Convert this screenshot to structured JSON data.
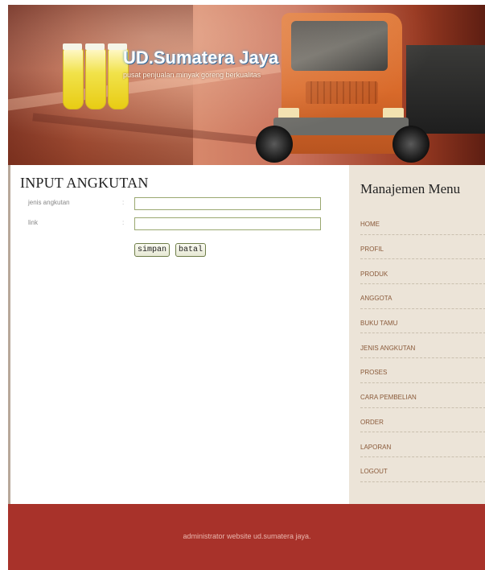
{
  "header": {
    "brand": "UD.Sumatera Jaya",
    "tagline": "pusat penjualan minyak goreng berkualitas"
  },
  "main": {
    "title": "INPUT ANGKUTAN",
    "fields": [
      {
        "label": "jenis angkutan",
        "colon": ":",
        "value": ""
      },
      {
        "label": "link",
        "colon": ":",
        "value": ""
      }
    ],
    "buttons": {
      "save": "simpan",
      "cancel": "batal"
    }
  },
  "sidebar": {
    "title": "Manajemen Menu",
    "items": [
      "HOME",
      "PROFIL",
      "PRODUK",
      "ANGGOTA",
      "BUKU TAMU",
      "JENIS ANGKUTAN",
      "PROSES",
      "CARA PEMBELIAN",
      "ORDER",
      "LAPORAN",
      "LOGOUT"
    ]
  },
  "footer": {
    "text": "administrator website ud.sumatera jaya."
  },
  "colors": {
    "footer": "#a8322a",
    "sidebar": "#ece4d8",
    "menu_text": "#8a5a3a"
  }
}
